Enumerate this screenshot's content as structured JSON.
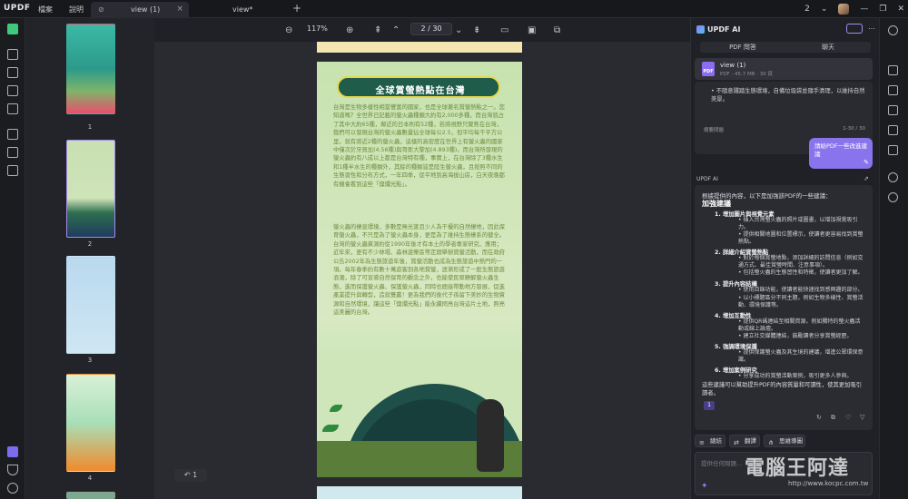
{
  "app": {
    "logo": "UPDF",
    "menus": [
      "檔案",
      "說明"
    ],
    "tabs": [
      {
        "label": "view (1)",
        "active": true
      },
      {
        "label": "view*",
        "active": false
      }
    ],
    "page_indicator": "2",
    "close": "×",
    "add_tab": "+"
  },
  "thumbnails": [
    {
      "num": "1"
    },
    {
      "num": "2"
    },
    {
      "num": "3"
    },
    {
      "num": "4"
    }
  ],
  "toolbar": {
    "zoom": "117%",
    "page": "2 / 30"
  },
  "document": {
    "banner": "全球賞螢熱點在台灣",
    "para1": "台灣是生物多樣性相當豐富的國家，也是全球著名賞螢熱點之一。您知道嗎？全世界已記載的螢火蟲種類大約有2,000多種，而台灣就占了其中大約65種，鄰近的日本則有52種，若將視野只聚焦在台灣，我們可以發現台灣的螢火蟲數量佔全球每公2.5，但平均每千平方公里，就有將近2種的螢火蟲，這樣的高密度在世界上有螢火蟲的國家中僅次於牙買加(4.56種)與哥斯大黎加(4.893種)。而台灣所發現的螢火蟲約有八成以上都是台灣特有種，事實上，在台灣除了3種水生和1種半水生的種類外，其餘的種類皆是陸生螢火蟲，且按照不同的生態習性和分布方式，一年四季，從平地到高海拔山區，白天夜晚都有機會看到這些「燦爛光點」。",
    "para2": "螢火蟲的棲息環境，多數是無光害且少人為干擾的自然棲地，因此保育螢火蟲，不只是為了螢火蟲本身，更是為了維持生態棲系的健全。台灣的螢火蟲資源約從1990年後才有本土的學者專家研究、應用；近年來，更有不少林場、森林遊樂區等定期舉辦賞螢活動，而在政府公告2002年為生態旅遊年後，賞螢活動也成為生態旅遊中熱門的一項。每年春季約有數十萬遊客到各地賞螢，逐漸形成了一股生態旅遊浪潮，除了可宣導自然保育的觀念之外，也能使民眾瞭解螢火蟲生態，進而保護螢火蟲、保護螢火蟲，同時也間接帶動地方發展，促進產業提升與轉型，造就雙贏！更為我們的後代子孫留下美妙的生物資源和自然環境，讓這些「燦爛光點」能永續閃亮台灣這片土地，照亮這美麗的台灣。",
    "undo": "↶ 1"
  },
  "ai": {
    "title": "UPDF AI",
    "tabs": [
      "PDF 問答",
      "聊天"
    ],
    "file": {
      "name": "view (1)",
      "meta": "PDF · 45.7 MB · 30 頁"
    },
    "chunk": {
      "text": "• 不隨意踐踏生態環境，自備垃圾袋並隨手清理，以維持自然美景。",
      "label": "摘要問題",
      "count": "1-30 / 30"
    },
    "user_msg": "請給PDF一些改進建議",
    "reply_label": "UPDF AI",
    "reply": {
      "intro": "根據提供的內容，以下是加強該PDF的一些建議：",
      "heading": "加強建議",
      "sections": [
        {
          "title": "1. 增加圖片與視覺元素",
          "bullets": [
            "插入台灣螢火蟲的照片或圖畫，以增加視覺吸引力。",
            "提供相關地圖和位置標示，使讀者更容易找到賞螢熱點。"
          ]
        },
        {
          "title": "2. 詳細介紹賞螢熱點",
          "bullets": [
            "對於每個賞螢地點，添加詳細的訪問信息（例如交通方式、最佳賞螢時間、注意事項）。",
            "包括螢火蟲的生態習性和特徵，使讀者更加了解。"
          ]
        },
        {
          "title": "3. 提升內容結構",
          "bullets": [
            "使用目錄功能，使讀者能快速找到感興趣的部分。",
            "以小標題區分不同主題，例如生物多樣性、賞螢活動、環境保護等。"
          ]
        },
        {
          "title": "4. 增加互動性",
          "bullets": [
            "提供QR碼連結至相關資源，例如獨特的螢火蟲活動或線上論壇。",
            "建立社交媒體連結，鼓勵讀者分享賞螢經歷。"
          ]
        },
        {
          "title": "5. 強調環境保護",
          "bullets": [
            "提供保護螢火蟲及其生境的建議，增進公眾環保意識。"
          ]
        },
        {
          "title": "6. 增加案例研究",
          "bullets": [
            "分享成功的賞螢活動案例，吸引更多人參與。"
          ]
        }
      ],
      "ending": "這些建議可以幫助提升PDF的內容質量和可讀性，使其更加吸引讀者。",
      "page_ref": "1"
    },
    "chips": [
      "總結",
      "翻譯",
      "思維導圖"
    ],
    "input_placeholder": "提供任何問題..."
  },
  "watermark": {
    "text": "電腦王阿達",
    "url": "http://www.kocpc.com.tw"
  }
}
